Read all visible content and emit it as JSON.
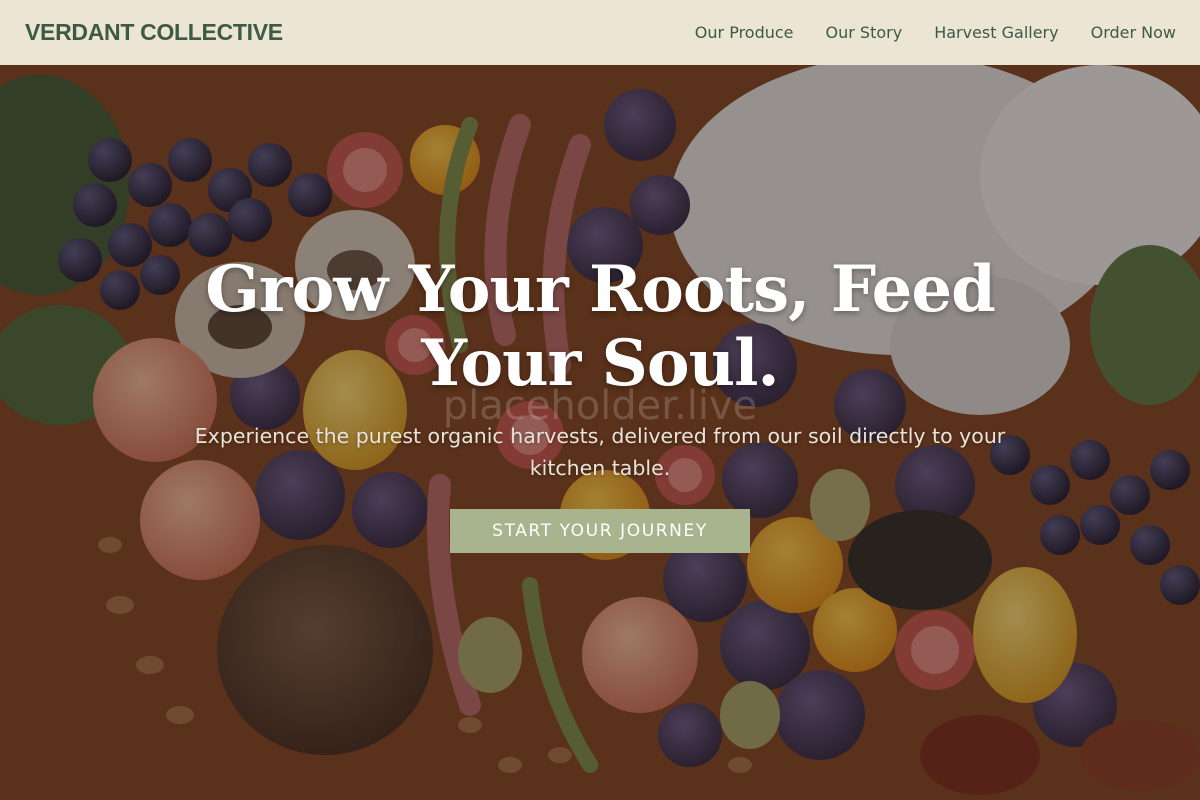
{
  "header": {
    "brand": "VERDANT COLLECTIVE",
    "nav": [
      {
        "label": "Our Produce"
      },
      {
        "label": "Our Story"
      },
      {
        "label": "Harvest Gallery"
      },
      {
        "label": "Order Now"
      }
    ]
  },
  "hero": {
    "headline_line1": "Grow Your Roots, Feed",
    "headline_line2": "Your Soul.",
    "watermark": "placeholder.live",
    "subtitle": "Experience the purest organic harvests, delivered from our soil directly to your kitchen table.",
    "cta_label": "START YOUR JOURNEY"
  },
  "colors": {
    "header_bg": "#ece5d4",
    "brand_green": "#3d5a45",
    "cta_bg": "#a7b48e"
  }
}
